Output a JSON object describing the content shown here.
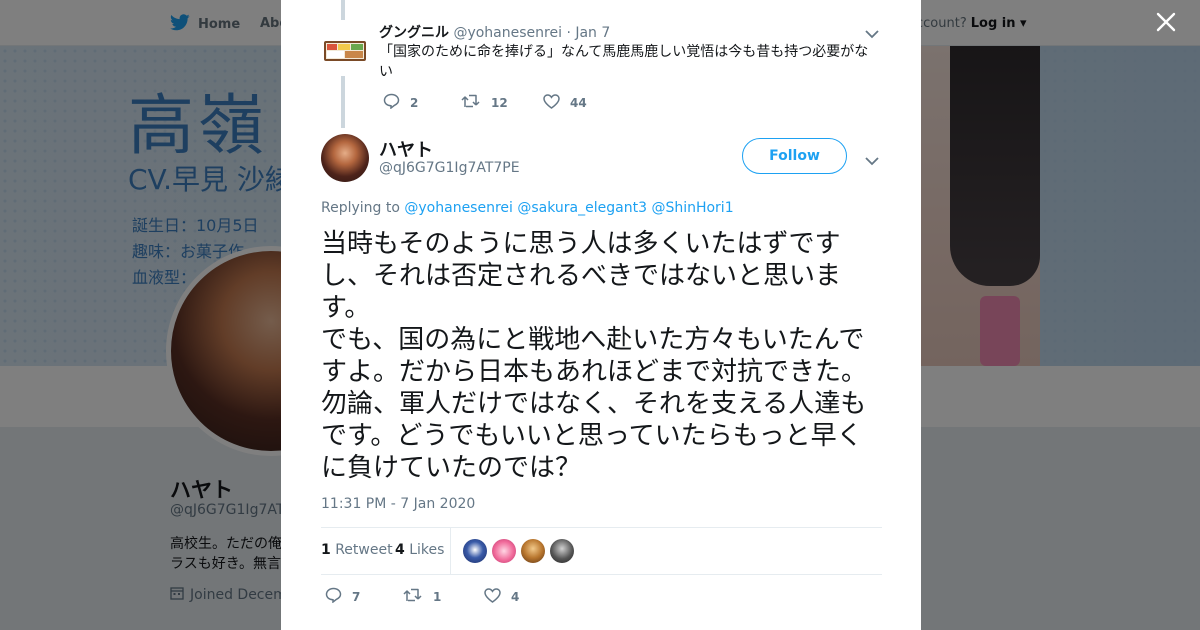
{
  "background": {
    "nav": {
      "home_label": "Home",
      "about_label": "Abo",
      "account_prompt": "ccount?",
      "login_label": "Log in"
    },
    "banner": {
      "title": "高嶺",
      "cv": "CV.早見 沙綾",
      "lines": [
        "誕生日：10月5日",
        "趣味：お菓子作",
        "血液型："
      ]
    },
    "profile": {
      "name": "ハヤト",
      "handle": "@qJ6G7G1Ig7AT",
      "bio_line1": "高校生。ただの俺",
      "bio_line2": "ラスも好き。無言",
      "joined": "Joined Decem"
    }
  },
  "modal": {
    "parent_tweet": {
      "name": "グングニル",
      "handle": "@yohanesenrei",
      "separator": "·",
      "date": "Jan 7",
      "text": "「国家のために命を捧げる」なんて馬鹿馬鹿しい覚悟は今も昔も持つ必要がない",
      "reply_count": "2",
      "retweet_count": "12",
      "like_count": "44"
    },
    "main_tweet": {
      "name": "ハヤト",
      "handle": "@qJ6G7G1Ig7AT7PE",
      "follow_label": "Follow",
      "replying_prefix": "Replying to",
      "mentions": [
        "@yohanesenrei",
        "@sakura_elegant3",
        "@ShinHori1"
      ],
      "text": "当時もそのように思う人は多くいたはずですし、それは否定されるべきではないと思います。\nでも、国の為にと戦地へ赴いた方々もいたんですよ。だから日本もあれほどまで対抗できた。勿論、軍人だけではなく、それを支える人達もです。どうでもいいと思っていたらもっと早くに負けていたのでは？",
      "timestamp": "11:31 PM - 7 Jan 2020",
      "retweet_stat_count": "1",
      "retweet_stat_label": "Retweet",
      "like_stat_count": "4",
      "like_stat_label": "Likes",
      "reply_count": "7",
      "retweet_count": "1",
      "like_count": "4"
    }
  },
  "colors": {
    "accent": "#1da1f2",
    "text": "#14171a",
    "muted": "#657786",
    "border": "#e6ecf0"
  },
  "icons": [
    "twitter-bird-icon",
    "close-icon",
    "reply-icon",
    "retweet-icon",
    "heart-icon",
    "chevron-down-icon",
    "calendar-icon"
  ]
}
